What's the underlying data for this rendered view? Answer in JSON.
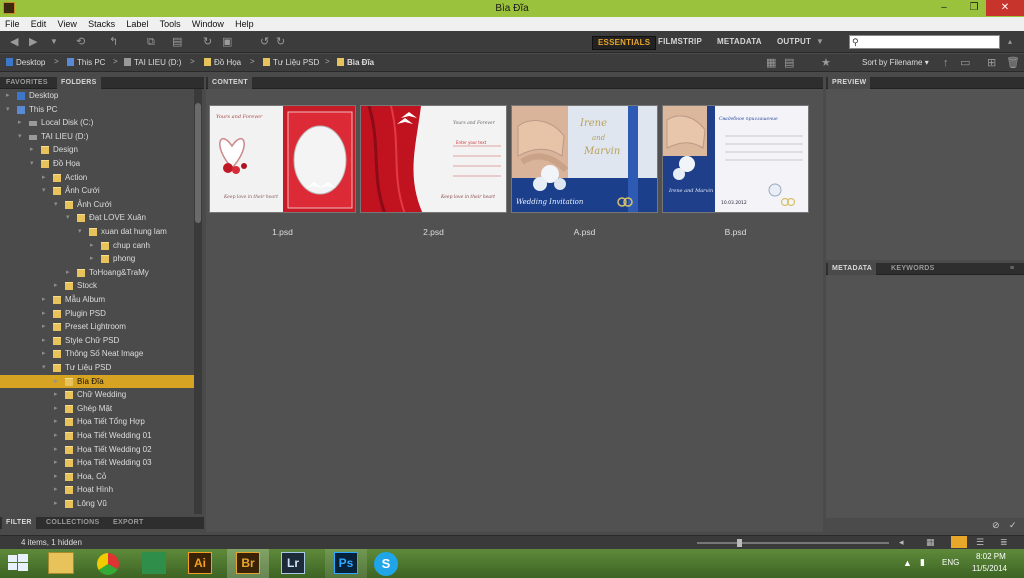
{
  "window": {
    "title": "Bìa Đĩa",
    "min": "–",
    "max": "❐",
    "close": "✕"
  },
  "menu": [
    "File",
    "Edit",
    "View",
    "Stacks",
    "Label",
    "Tools",
    "Window",
    "Help"
  ],
  "workspaces": {
    "active": "ESSENTIALS",
    "others": [
      "FILMSTRIP",
      "METADATA",
      "OUTPUT"
    ]
  },
  "search": {
    "placeholder": ""
  },
  "path": [
    {
      "label": "Desktop"
    },
    {
      "label": "This PC"
    },
    {
      "label": "TAI LIEU (D:)"
    },
    {
      "label": "Đồ Họa"
    },
    {
      "label": "Tư Liệu PSD"
    },
    {
      "label": "Bìa Đĩa"
    }
  ],
  "sort_label": "Sort by Filename",
  "panels": {
    "left_tabs": [
      "FAVORITES",
      "FOLDERS"
    ],
    "filter_tabs": [
      "FILTER",
      "COLLECTIONS",
      "EXPORT"
    ],
    "content_tab": "CONTENT",
    "preview_tab": "PREVIEW",
    "meta_tabs": [
      "METADATA",
      "KEYWORDS"
    ]
  },
  "tree": [
    {
      "label": "Desktop",
      "depth": 0,
      "type": "desktop",
      "expanded": false
    },
    {
      "label": "This PC",
      "depth": 0,
      "type": "pc",
      "expanded": true
    },
    {
      "label": "Local Disk (C:)",
      "depth": 1,
      "type": "drive",
      "expanded": false
    },
    {
      "label": "TAI LIEU (D:)",
      "depth": 1,
      "type": "drive",
      "expanded": true
    },
    {
      "label": "Design",
      "depth": 2,
      "type": "folder",
      "expanded": false
    },
    {
      "label": "Đồ Họa",
      "depth": 2,
      "type": "folder",
      "expanded": true
    },
    {
      "label": "Action",
      "depth": 3,
      "type": "folder",
      "expanded": false
    },
    {
      "label": "Ảnh Cưới",
      "depth": 3,
      "type": "folder",
      "expanded": true
    },
    {
      "label": "Ảnh Cưới",
      "depth": 4,
      "type": "folder",
      "expanded": true
    },
    {
      "label": "Đạt LOVE Xuân",
      "depth": 5,
      "type": "folder",
      "expanded": true
    },
    {
      "label": "xuan dat hung lam",
      "depth": 6,
      "type": "folder",
      "expanded": true
    },
    {
      "label": "chup canh",
      "depth": 7,
      "type": "folder",
      "expanded": false
    },
    {
      "label": "phong",
      "depth": 7,
      "type": "folder",
      "expanded": false
    },
    {
      "label": "ToHoang&TraMy",
      "depth": 5,
      "type": "folder",
      "expanded": false
    },
    {
      "label": "Stock",
      "depth": 4,
      "type": "folder",
      "expanded": false
    },
    {
      "label": "Mẫu Album",
      "depth": 3,
      "type": "folder",
      "expanded": false
    },
    {
      "label": "Plugin PSD",
      "depth": 3,
      "type": "folder",
      "expanded": false
    },
    {
      "label": "Preset Lightroom",
      "depth": 3,
      "type": "folder",
      "expanded": false
    },
    {
      "label": "Style Chữ PSD",
      "depth": 3,
      "type": "folder",
      "expanded": false
    },
    {
      "label": "Thông Số Neat Image",
      "depth": 3,
      "type": "folder",
      "expanded": false
    },
    {
      "label": "Tư Liệu PSD",
      "depth": 3,
      "type": "folder",
      "expanded": true
    },
    {
      "label": "Bìa Đĩa",
      "depth": 4,
      "type": "folder",
      "expanded": false,
      "selected": true
    },
    {
      "label": "Chữ  Wedding",
      "depth": 4,
      "type": "folder",
      "expanded": false
    },
    {
      "label": "Ghép Mặt",
      "depth": 4,
      "type": "folder",
      "expanded": false
    },
    {
      "label": "Họa Tiết Tổng Hợp",
      "depth": 4,
      "type": "folder",
      "expanded": false
    },
    {
      "label": "Họa Tiết Wedding 01",
      "depth": 4,
      "type": "folder",
      "expanded": false
    },
    {
      "label": "Họa Tiết Wedding 02",
      "depth": 4,
      "type": "folder",
      "expanded": false
    },
    {
      "label": "Họa Tiết Wedding 03",
      "depth": 4,
      "type": "folder",
      "expanded": false
    },
    {
      "label": "Hoa, Cỏ",
      "depth": 4,
      "type": "folder",
      "expanded": false
    },
    {
      "label": "Hoạt Hình",
      "depth": 4,
      "type": "folder",
      "expanded": false
    },
    {
      "label": "Lông Vũ",
      "depth": 4,
      "type": "folder",
      "expanded": false
    }
  ],
  "files": [
    {
      "name": "1.psd",
      "style": "red-heart",
      "texts": [
        "Yours and Forever",
        "Keep love in their heart"
      ]
    },
    {
      "name": "2.psd",
      "style": "red-curtain",
      "texts": [
        "Yours and Forever",
        "Enter your text",
        "Keep love in their heart"
      ]
    },
    {
      "name": "A.psd",
      "style": "blue-rings",
      "texts": [
        "Irene",
        "and",
        "Marvin",
        "Wedding Invitation"
      ]
    },
    {
      "name": "B.psd",
      "style": "blue-card",
      "texts": [
        "Свадебное приглашение",
        "Irene and Marvin",
        "10.03.2012"
      ]
    }
  ],
  "status": {
    "text": "4 items, 1 hidden"
  },
  "taskbar": {
    "apps": [
      "Ai",
      "Br",
      "Lr",
      "Ps"
    ],
    "lang": "ENG",
    "time": "8:02 PM",
    "date": "11/5/2014"
  },
  "colors": {
    "accent": "#e8a62a",
    "selection": "#d7a322",
    "titlebar": "#9bc23c"
  }
}
